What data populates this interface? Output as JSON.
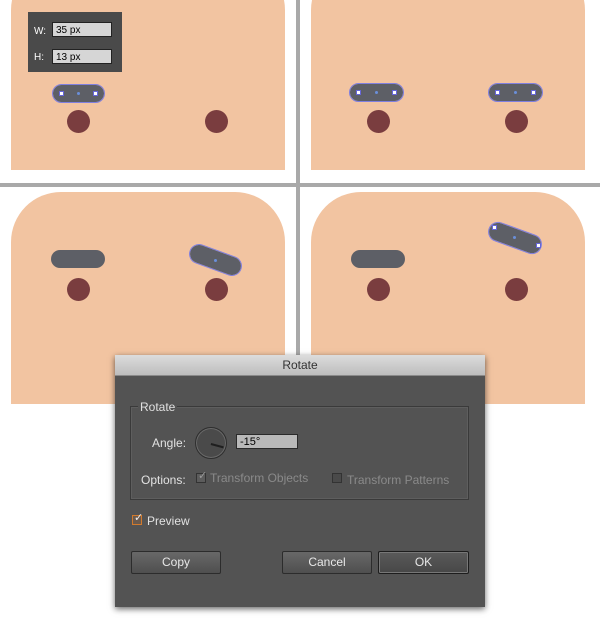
{
  "colors": {
    "skin": "#f2c4a1",
    "eye": "#7a3d3f",
    "eyebrow": "#5d5f66",
    "selection": "#7f7fe0",
    "dialog_bg": "#535353",
    "divider": "#a9a9a9"
  },
  "dimensions_tooltip": {
    "w_label": "W:",
    "w_value": "35 px",
    "h_label": "H:",
    "h_value": "13 px"
  },
  "dialog": {
    "title": "Rotate",
    "group_title": "Rotate",
    "angle_label": "Angle:",
    "angle_value": "-15°",
    "options_label": "Options:",
    "transform_objects": {
      "label": "Transform Objects",
      "checked": true,
      "enabled": false
    },
    "transform_patterns": {
      "label": "Transform Patterns",
      "checked": false,
      "enabled": false
    },
    "preview": {
      "label": "Preview",
      "checked": true
    },
    "buttons": {
      "copy": "Copy",
      "cancel": "Cancel",
      "ok": "OK"
    }
  }
}
